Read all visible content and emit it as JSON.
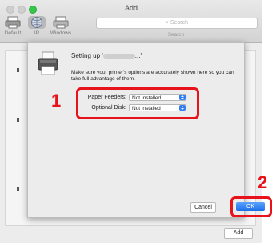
{
  "window": {
    "title": "Add"
  },
  "toolbar": {
    "items": [
      {
        "label": "Default"
      },
      {
        "label": "IP"
      },
      {
        "label": "Windows"
      }
    ],
    "search_placeholder": "Search",
    "search_label": "Search"
  },
  "sheet": {
    "heading_prefix": "Setting up '",
    "heading_suffix": "...'",
    "description": "Make sure your printer's options are accurately shown here so you can take full advantage of them.",
    "options": [
      {
        "label": "Paper Feeders:",
        "value": "Not Installed"
      },
      {
        "label": "Optional Disk:",
        "value": "Not installed"
      }
    ],
    "cancel_label": "Cancel",
    "ok_label": "OK"
  },
  "annotations": {
    "step1": "1",
    "step2": "2"
  },
  "footer": {
    "add_label": "Add"
  },
  "colors": {
    "annotation_red": "#e8121b",
    "accent_blue": "#2f7ef6",
    "traffic_green": "#34c84a"
  }
}
